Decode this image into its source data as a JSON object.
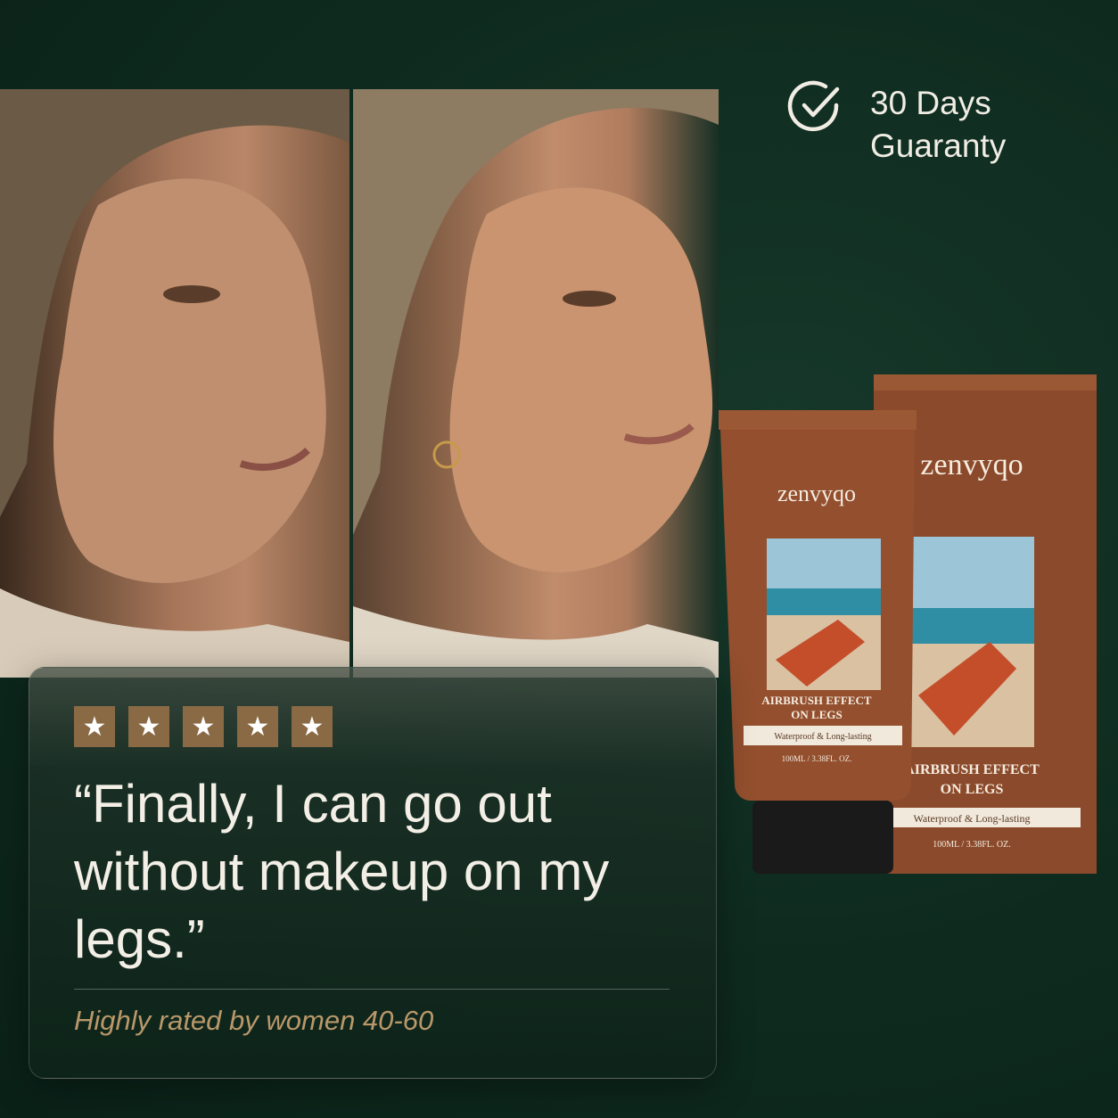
{
  "guarantee": {
    "icon": "check-circle-icon",
    "line1": "30 Days",
    "line2": "Guaranty"
  },
  "product": {
    "brand": "zenvyqo",
    "name_line1": "AIRBRUSH EFFECT",
    "name_line2": "ON LEGS",
    "tagline": "Waterproof & Long-lasting",
    "volume": "100ML / 3.38FL. OZ."
  },
  "review": {
    "stars": [
      "★",
      "★",
      "★",
      "★",
      "★"
    ],
    "quote": "“Finally, I can go out without makeup on my legs.”",
    "subline": "Highly rated by women 40-60"
  },
  "colors": {
    "background": "#0e2a1e",
    "star_box": "#8a6a44",
    "product_brown": "#8b4a2b",
    "accent_gold": "#b9986a"
  }
}
